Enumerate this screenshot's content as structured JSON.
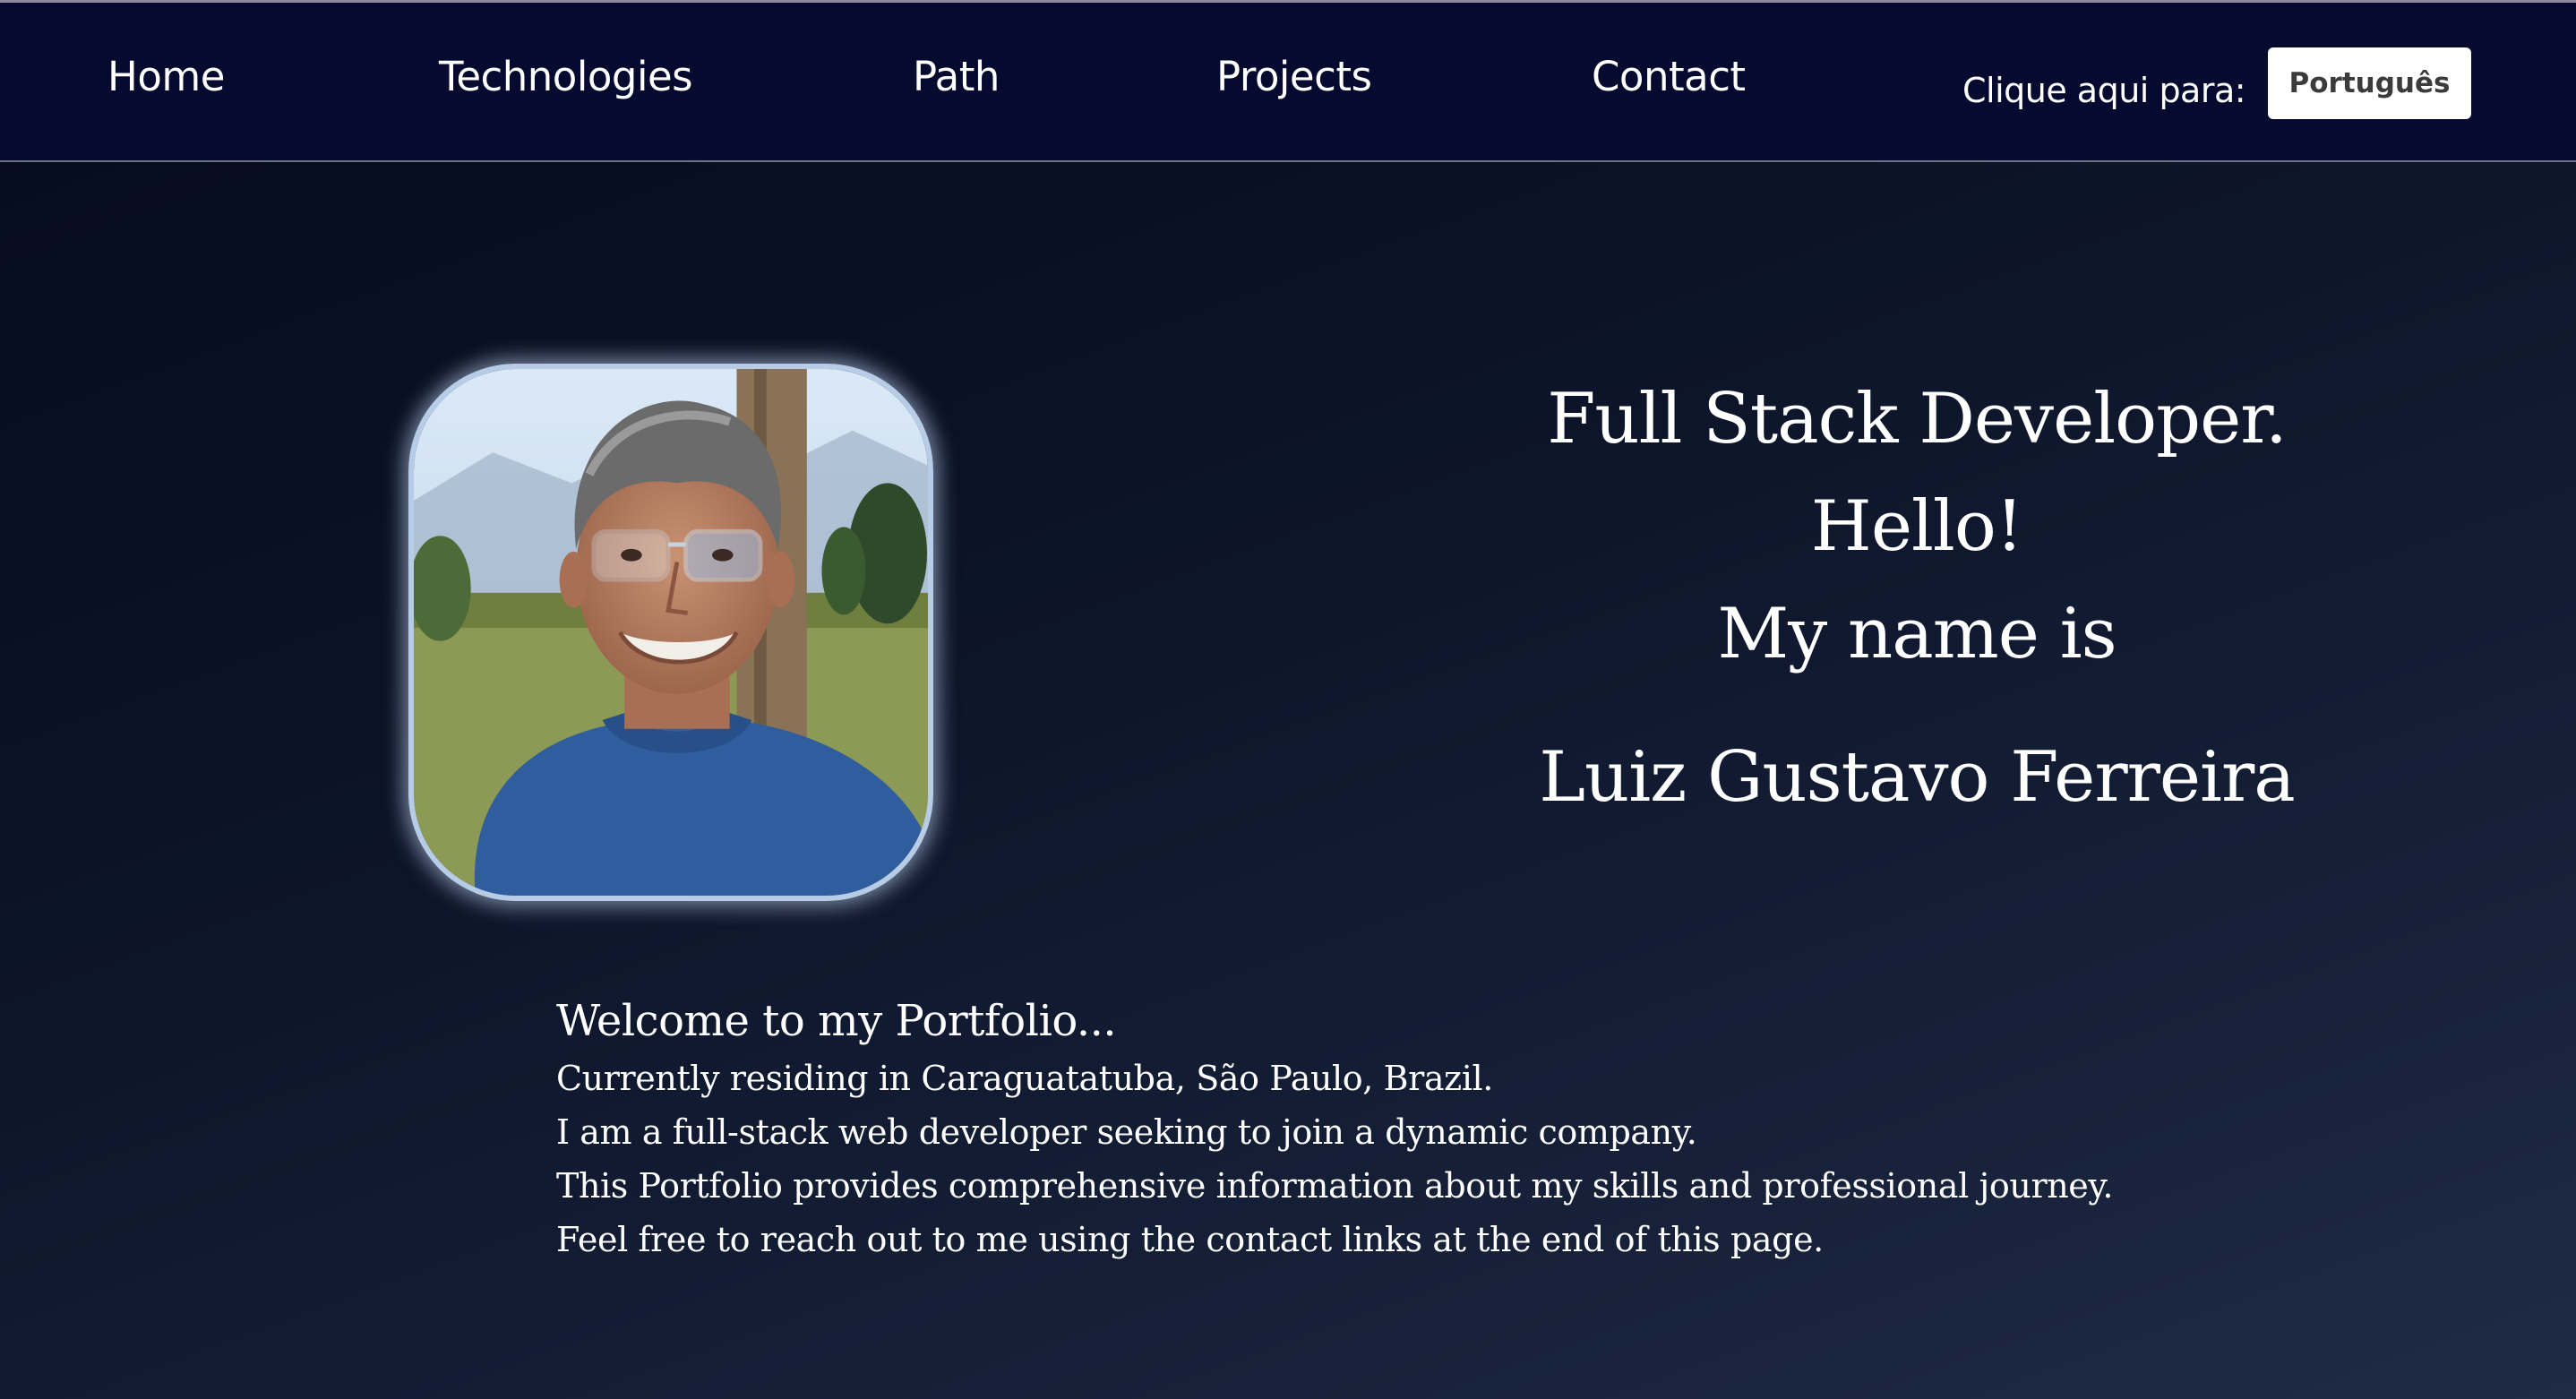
{
  "nav": {
    "items": [
      {
        "label": "Home"
      },
      {
        "label": "Technologies"
      },
      {
        "label": "Path"
      },
      {
        "label": "Projects"
      },
      {
        "label": "Contact"
      }
    ],
    "language_prompt": "Clique aqui para:",
    "language_button": "Português"
  },
  "hero": {
    "lines": [
      "Full Stack Developer.",
      "Hello!",
      "My name is"
    ],
    "name": "Luiz Gustavo Ferreira"
  },
  "welcome": {
    "title": "Welcome to my Portfolio...",
    "lines": [
      "Currently residing in Caraguatatuba, São Paulo, Brazil.",
      "I am a full-stack web developer seeking to join a dynamic company.",
      "This Portfolio provides comprehensive information about my skills and professional journey.",
      "Feel free to reach out to me using the contact links at the end of this page."
    ]
  },
  "colors": {
    "navbar": "#050a2e",
    "background_start": "#060b1f",
    "background_end": "#1f2b44",
    "photo_border": "#b7cce6"
  }
}
